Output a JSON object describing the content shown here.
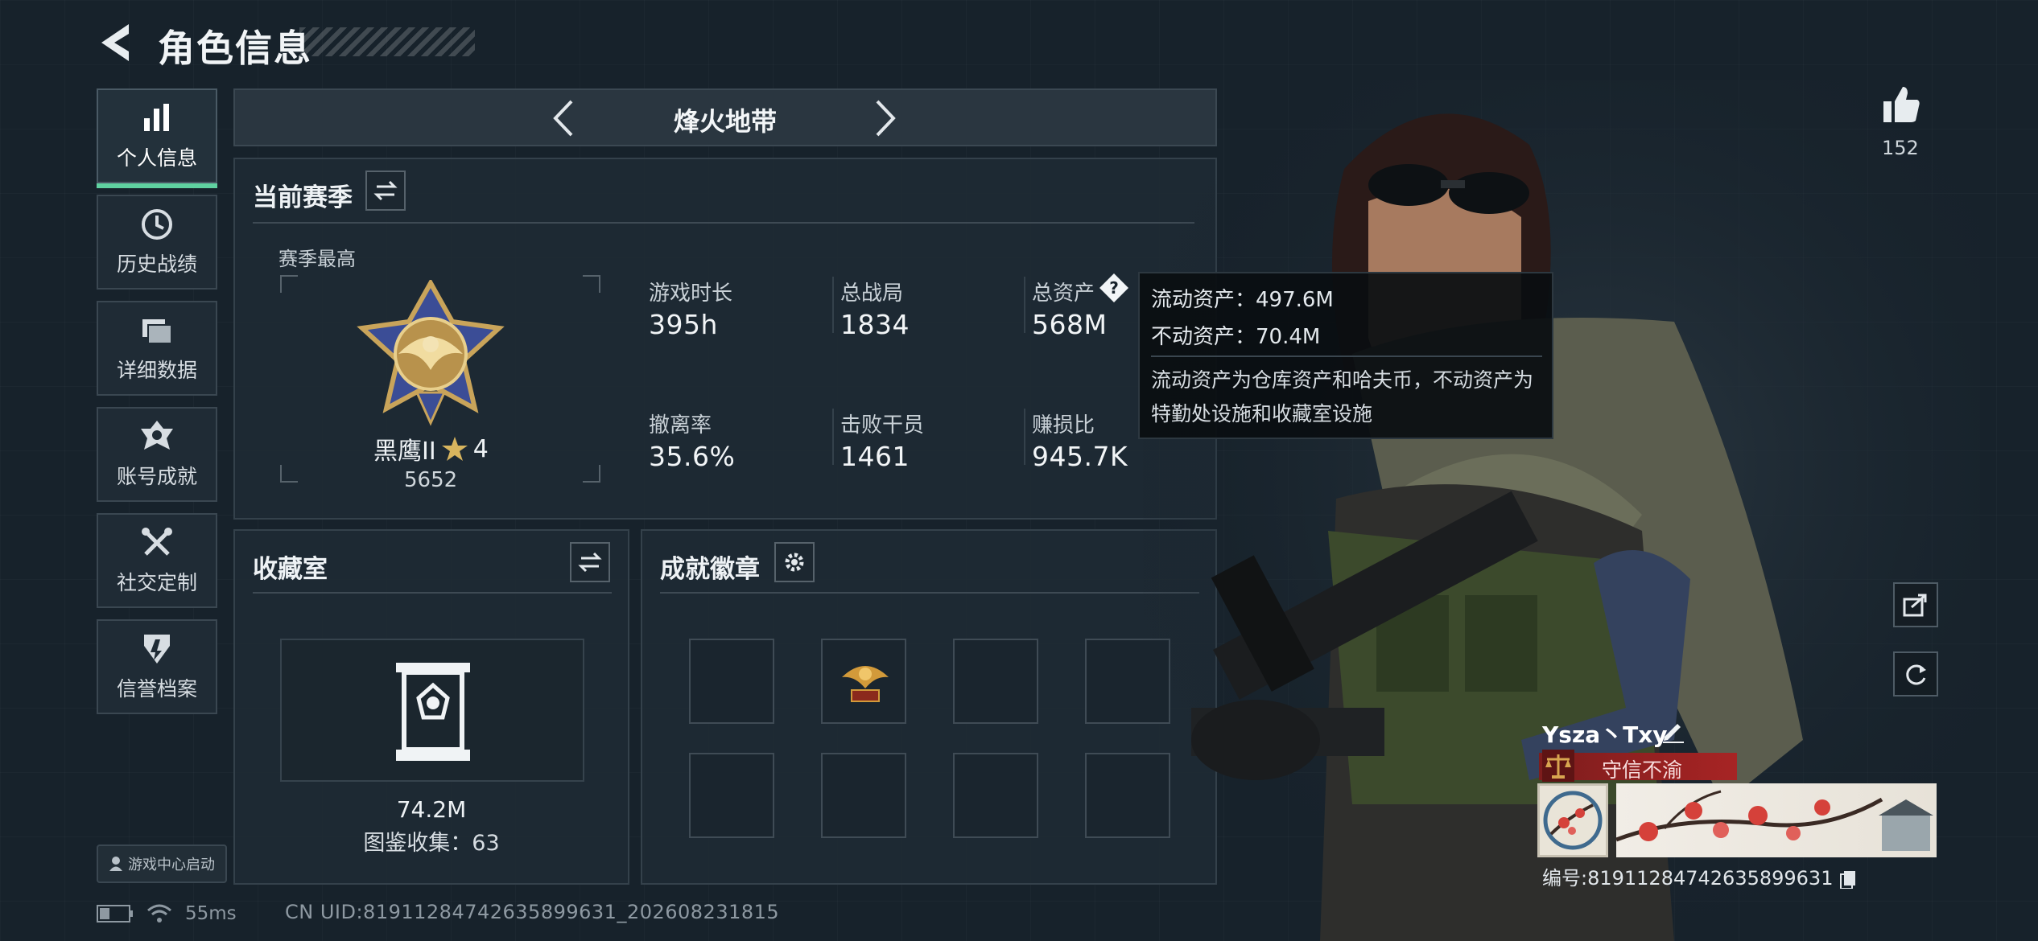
{
  "header": {
    "title": "角色信息"
  },
  "sidebar": {
    "items": [
      {
        "label": "个人信息",
        "icon": "bar-chart-icon",
        "active": true
      },
      {
        "label": "历史战绩",
        "icon": "clock-icon"
      },
      {
        "label": "详细数据",
        "icon": "folder-icon"
      },
      {
        "label": "账号成就",
        "icon": "medal-icon"
      },
      {
        "label": "社交定制",
        "icon": "tools-icon"
      },
      {
        "label": "信誉档案",
        "icon": "shield-icon"
      }
    ],
    "launch_label": "游戏中心启动"
  },
  "mode": {
    "title": "烽火地带"
  },
  "season": {
    "title": "当前赛季",
    "best_label": "赛季最高",
    "rank_name": "黑鹰II",
    "rank_stars": "4",
    "rank_score": "5652",
    "stats": [
      {
        "label": "游戏时长",
        "value": "395h"
      },
      {
        "label": "总战局",
        "value": "1834"
      },
      {
        "label": "总资产",
        "value": "568M"
      },
      {
        "label": "撤离率",
        "value": "35.6%"
      },
      {
        "label": "击败干员",
        "value": "1461"
      },
      {
        "label": "赚损比",
        "value": "945.7K"
      }
    ]
  },
  "tooltip": {
    "liquid": "流动资产：497.6M",
    "fixed": "不动资产：70.4M",
    "note": "流动资产为仓库资产和哈夫币，不动资产为特勤处设施和收藏室设施"
  },
  "collection": {
    "title": "收藏室",
    "value": "74.2M",
    "codex_label": "图鉴收集：63"
  },
  "achievements": {
    "title": "成就徽章"
  },
  "likes": {
    "count": "152"
  },
  "profile": {
    "nickname": "Ysza丶Txy",
    "motto": "守信不渝",
    "id_label": "编号:81911284742635899631"
  },
  "status": {
    "ping": "55ms",
    "uid": "CN UID:81911284742635899631_202608231815"
  },
  "colors": {
    "accent_green": "#5fd1a0",
    "motto_red": "#a72424",
    "panel_bg": "#1e2a34"
  }
}
